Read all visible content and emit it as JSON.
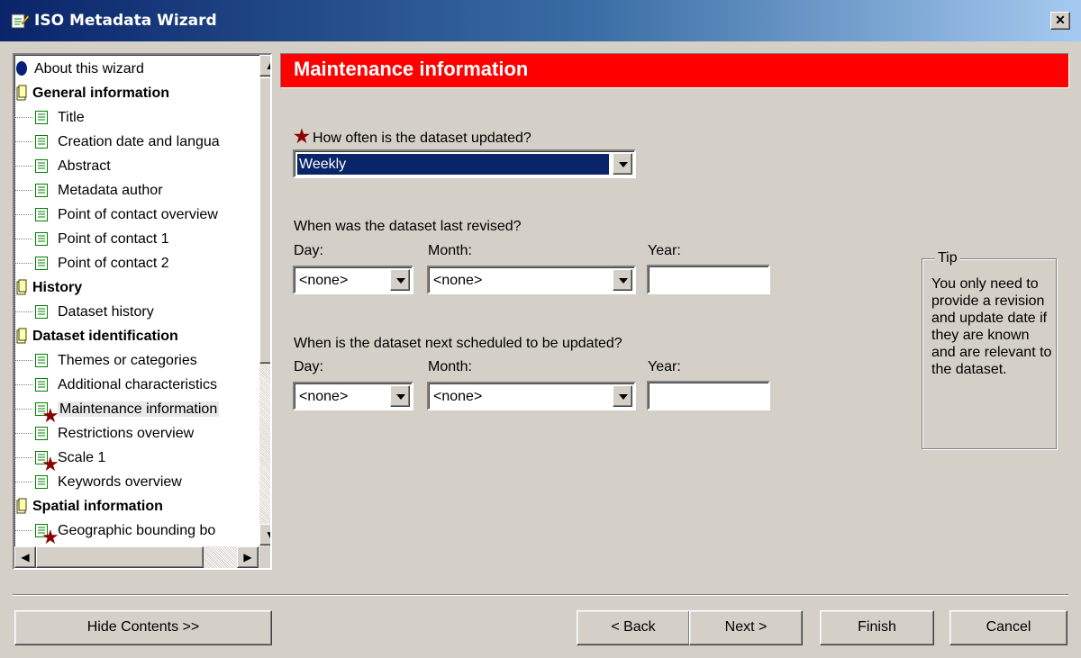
{
  "window": {
    "title": "ISO Metadata Wizard",
    "close_glyph": "✕"
  },
  "tree": {
    "items": [
      {
        "label": "About this wizard",
        "icon": "info-icon",
        "level": 0,
        "bold": false
      },
      {
        "label": "General information",
        "icon": "book-icon",
        "level": 0,
        "bold": true
      },
      {
        "label": "Title",
        "icon": "page-icon",
        "level": 1
      },
      {
        "label": "Creation date and langua",
        "icon": "page-icon",
        "level": 1
      },
      {
        "label": "Abstract",
        "icon": "page-icon",
        "level": 1
      },
      {
        "label": "Metadata author",
        "icon": "page-icon",
        "level": 1
      },
      {
        "label": "Point of contact overview",
        "icon": "page-icon",
        "level": 1
      },
      {
        "label": "Point of contact 1",
        "icon": "page-icon",
        "level": 1
      },
      {
        "label": "Point of contact 2",
        "icon": "page-icon",
        "level": 1
      },
      {
        "label": "History",
        "icon": "book-icon",
        "level": 0,
        "bold": true
      },
      {
        "label": "Dataset history",
        "icon": "page-icon",
        "level": 1
      },
      {
        "label": "Dataset identification",
        "icon": "book-icon",
        "level": 0,
        "bold": true
      },
      {
        "label": "Themes or categories",
        "icon": "page-icon",
        "level": 1
      },
      {
        "label": "Additional characteristics",
        "icon": "page-icon",
        "level": 1
      },
      {
        "label": "Maintenance information",
        "icon": "page-icon",
        "level": 1,
        "required": true,
        "selected": true
      },
      {
        "label": "Restrictions overview",
        "icon": "page-icon",
        "level": 1
      },
      {
        "label": "Scale 1",
        "icon": "page-icon",
        "level": 1,
        "required": true
      },
      {
        "label": "Keywords overview",
        "icon": "page-icon",
        "level": 1
      },
      {
        "label": "Spatial information",
        "icon": "book-icon",
        "level": 0,
        "bold": true
      },
      {
        "label": "Geographic bounding bo",
        "icon": "page-icon",
        "level": 1,
        "required": true
      }
    ]
  },
  "main": {
    "header": "Maintenance information",
    "required_glyph": "★",
    "frequency_question": "How often is the dataset updated?",
    "frequency_value": "Weekly",
    "revised_question": "When was the dataset last revised?",
    "next_question": "When is the dataset next scheduled to be updated?",
    "day_label": "Day:",
    "month_label": "Month:",
    "year_label": "Year:",
    "revised": {
      "day": "<none>",
      "month": "<none>",
      "year": ""
    },
    "next": {
      "day": "<none>",
      "month": "<none>",
      "year": ""
    }
  },
  "tip": {
    "title": "Tip",
    "text": "You only need to provide a revision and update date if they are known and are relevant to the dataset."
  },
  "buttons": {
    "hide_contents": "Hide Contents >>",
    "back": "< Back",
    "next": "Next >",
    "finish": "Finish",
    "cancel": "Cancel"
  },
  "colors": {
    "header_red": "#ff0000",
    "required_star": "#8b0000",
    "selection": "#0a246a"
  }
}
